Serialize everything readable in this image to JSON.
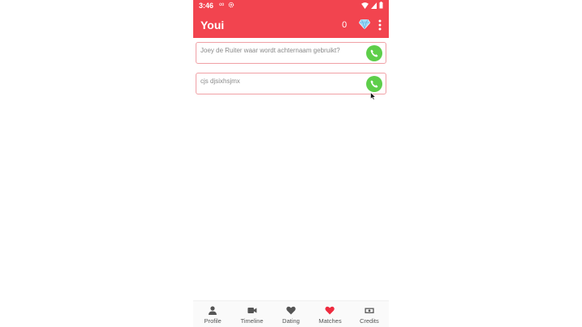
{
  "status": {
    "time": "3:46"
  },
  "app": {
    "title": "Youi",
    "credits_count": "0"
  },
  "chats": [
    {
      "text": "Joey de Ruiter waar wordt achternaam gebruikt?"
    },
    {
      "text": "cjs djsixhsjmx"
    }
  ],
  "nav": [
    {
      "label": "Profile",
      "icon": "person-icon"
    },
    {
      "label": "Timeline",
      "icon": "video-icon"
    },
    {
      "label": "Dating",
      "icon": "heart-icon"
    },
    {
      "label": "Matches",
      "icon": "heart-filled-icon"
    },
    {
      "label": "Credits",
      "icon": "money-icon"
    }
  ],
  "colors": {
    "accent": "#f2444f",
    "call": "#5ece4a",
    "matches_heart": "#ee2b3f"
  }
}
